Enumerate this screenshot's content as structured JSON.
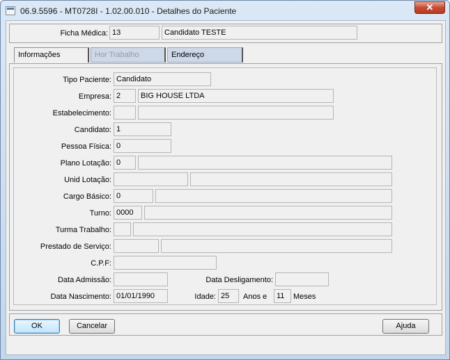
{
  "window": {
    "title": "06.9.5596 - MT0728I - 1.02.00.010 - Detalhes do Paciente",
    "close_symbol": "✕"
  },
  "header": {
    "ficha_label": "Ficha Médica:",
    "ficha_value": "13",
    "nome_value": "Candidato TESTE"
  },
  "tabs": [
    {
      "label": "Informações"
    },
    {
      "label": "Hor Trabalho"
    },
    {
      "label": "Endereço"
    }
  ],
  "form": {
    "tipo_paciente_label": "Tipo Paciente:",
    "tipo_paciente_value": "Candidato",
    "empresa_label": "Empresa:",
    "empresa_code": "2",
    "empresa_name": "BIG HOUSE LTDA",
    "estabelecimento_label": "Estabelecimento:",
    "estabelecimento_code": "",
    "estabelecimento_name": "",
    "candidato_label": "Candidato:",
    "candidato_value": "1",
    "pessoa_fisica_label": "Pessoa Física:",
    "pessoa_fisica_value": "0",
    "plano_lotacao_label": "Plano Lotação:",
    "plano_lotacao_code": "0",
    "plano_lotacao_desc": "",
    "unid_lotacao_label": "Unid Lotação:",
    "unid_lotacao_code": "",
    "unid_lotacao_desc": "",
    "cargo_basico_label": "Cargo Básico:",
    "cargo_basico_code": "0",
    "cargo_basico_desc": "",
    "turno_label": "Turno:",
    "turno_code": "0000",
    "turno_desc": "",
    "turma_trabalho_label": "Turma Trabalho:",
    "turma_trabalho_code": "",
    "turma_trabalho_desc": "",
    "prestado_servico_label": "Prestado de Serviço:",
    "prestado_servico_code": "",
    "prestado_servico_desc": "",
    "cpf_label": "C.P.F:",
    "cpf_value": "",
    "data_admissao_label": "Data Admissão:",
    "data_admissao_value": "",
    "data_desligamento_label": "Data Desligamento:",
    "data_desligamento_value": "",
    "data_nascimento_label": "Data Nascimento:",
    "data_nascimento_value": "01/01/1990",
    "idade_label": "Idade:",
    "idade_anos": "25",
    "anos_e_label": "Anos e",
    "idade_meses": "11",
    "meses_label": "Meses"
  },
  "buttons": {
    "ok": "OK",
    "cancelar": "Cancelar",
    "ajuda": "Ajuda"
  }
}
